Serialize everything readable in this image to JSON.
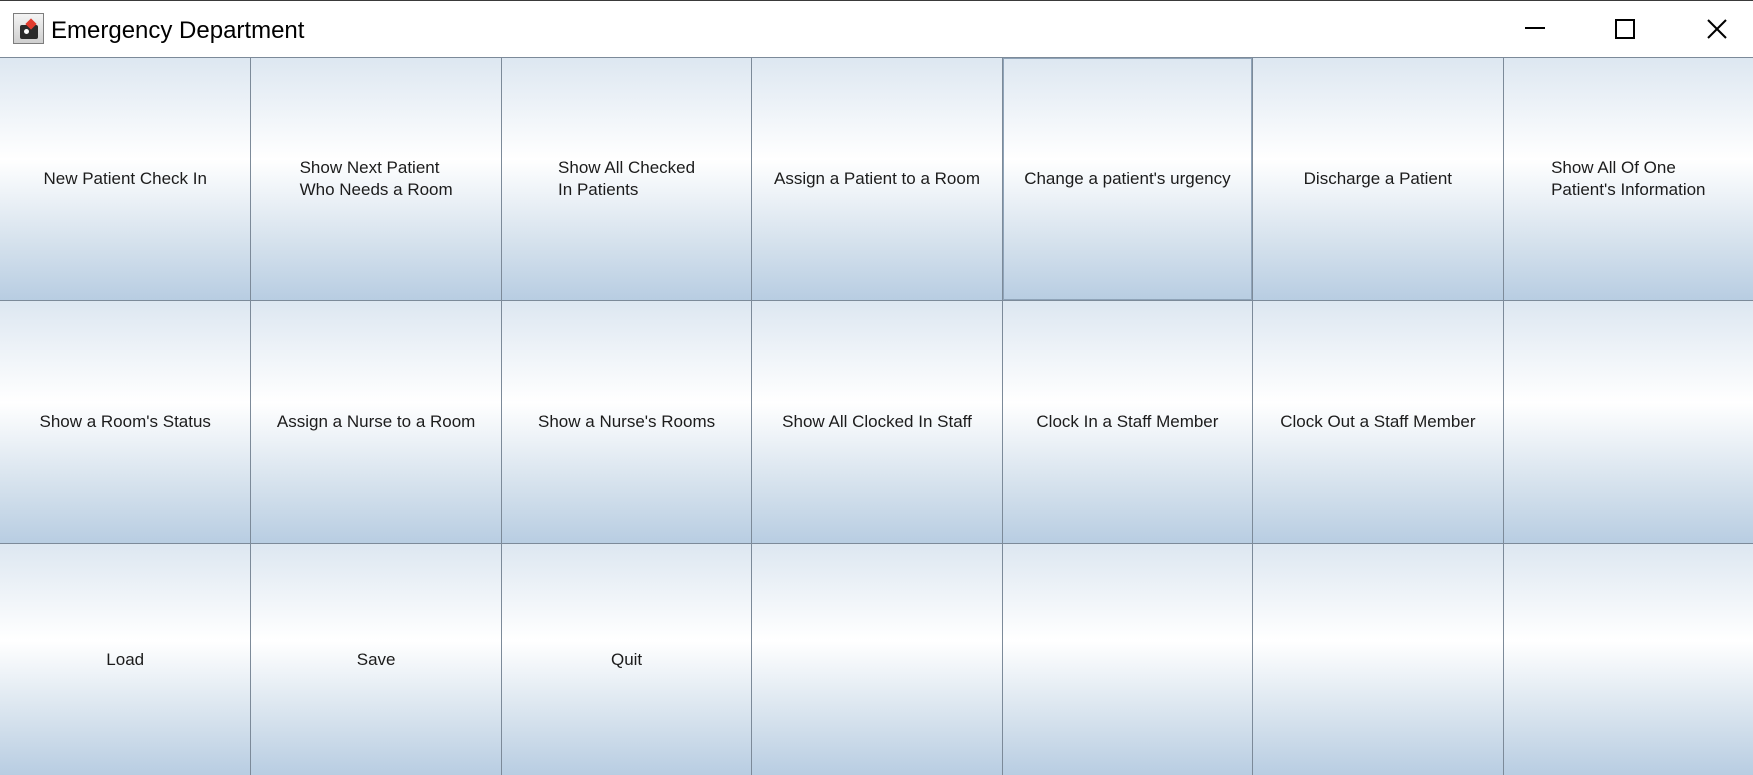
{
  "window": {
    "title": "Emergency Department",
    "icon": "java-duke-icon",
    "controls": [
      "minimize-icon",
      "maximize-icon",
      "close-icon"
    ]
  },
  "buttons": {
    "row1": [
      "New Patient Check In",
      "Show Next Patient\nWho Needs a Room",
      "Show All Checked\nIn Patients",
      "Assign a Patient to a Room",
      "Change a patient's urgency",
      "Discharge a Patient",
      "Show All Of One\nPatient's Information"
    ],
    "row2": [
      "Show a Room's Status",
      "Assign a Nurse to a Room",
      "Show a Nurse's Rooms",
      "Show All Clocked In Staff",
      "Clock In a Staff Member",
      "Clock Out a Staff Member",
      ""
    ],
    "row3": [
      "Load",
      "Save",
      "Quit",
      "",
      "",
      "",
      ""
    ]
  }
}
